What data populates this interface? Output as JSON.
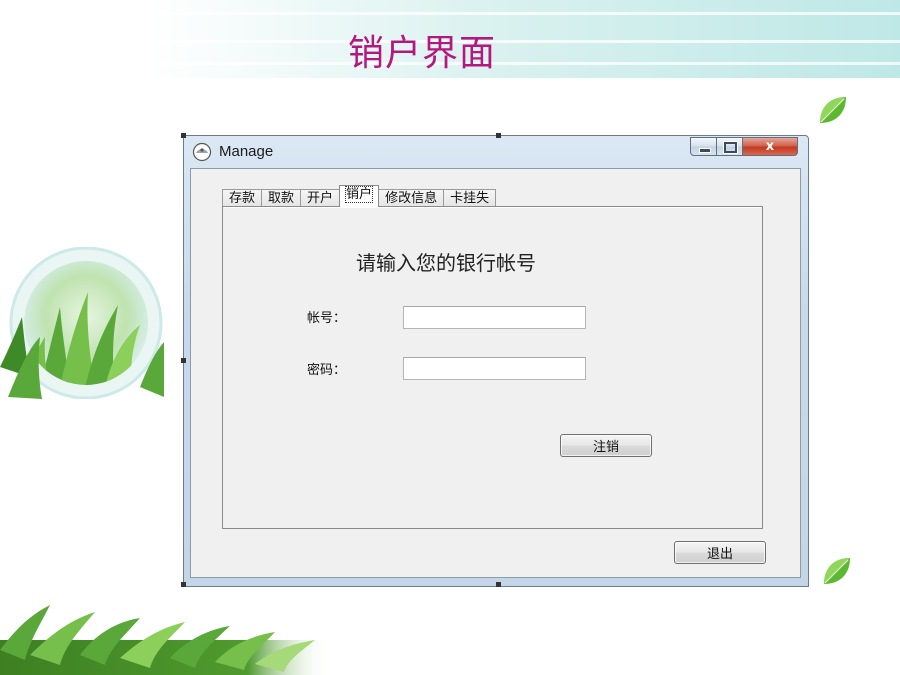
{
  "slide": {
    "title": "销户界面"
  },
  "window": {
    "title": "Manage",
    "close_glyph": "x"
  },
  "tabs": [
    {
      "label": "存款"
    },
    {
      "label": "取款"
    },
    {
      "label": "开户"
    },
    {
      "label": "销户",
      "active": true
    },
    {
      "label": "修改信息"
    },
    {
      "label": "卡挂失"
    }
  ],
  "form": {
    "prompt": "请输入您的银行帐号",
    "account_label": "帐号：",
    "account_value": "",
    "password_label": "密码：",
    "password_value": "",
    "cancel_account_button": "注销"
  },
  "footer": {
    "exit_button": "退出"
  },
  "colors": {
    "slide_title": "#b5177f",
    "leaf_green": "#5cb82e",
    "window_frame": "#c7d9ea",
    "close_button": "#c3391f"
  }
}
